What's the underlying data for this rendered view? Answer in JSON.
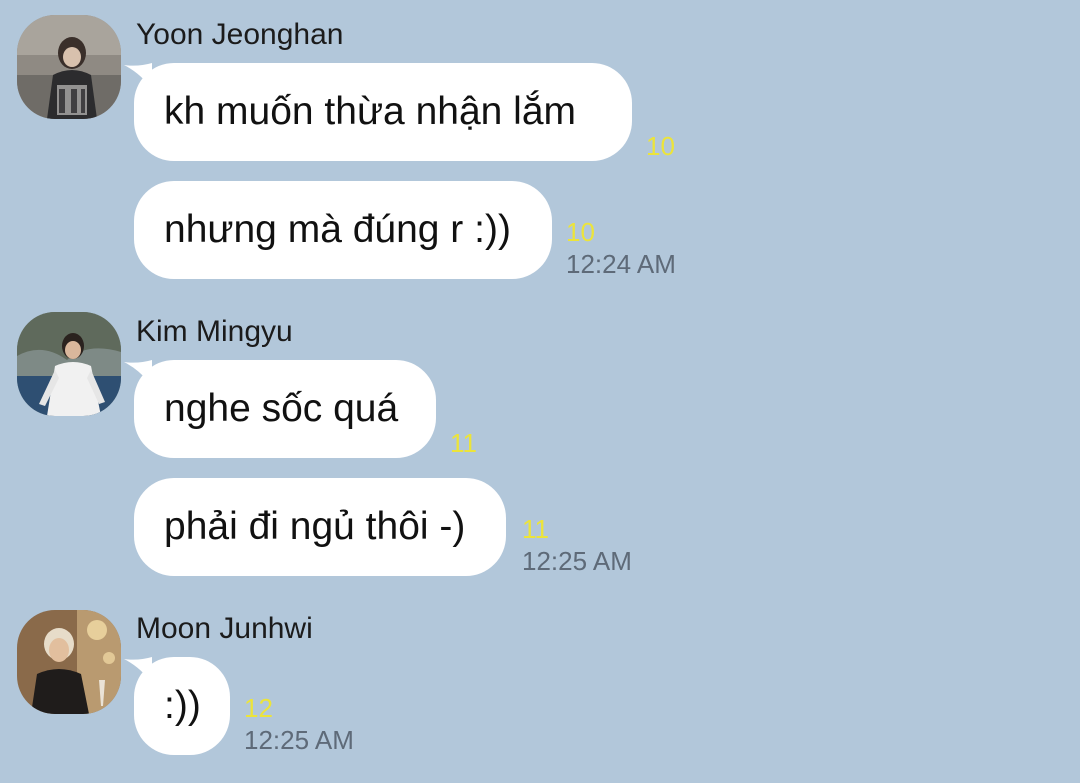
{
  "groups": [
    {
      "sender": "Yoon Jeonghan",
      "avatar_icon": "profile-photo-icon",
      "messages": [
        {
          "text": "kh muốn thừa nhận lắm",
          "unread": "10",
          "time": ""
        },
        {
          "text": "nhưng mà đúng r :))",
          "unread": "10",
          "time": "12:24 AM"
        }
      ]
    },
    {
      "sender": "Kim Mingyu",
      "avatar_icon": "profile-photo-icon",
      "messages": [
        {
          "text": "nghe sốc quá",
          "unread": "11",
          "time": ""
        },
        {
          "text": "phải đi ngủ thôi -)",
          "unread": "11",
          "time": "12:25 AM"
        }
      ]
    },
    {
      "sender": "Moon Junhwi",
      "avatar_icon": "profile-photo-icon",
      "messages": [
        {
          "text": ":))",
          "unread": "12",
          "time": "12:25 AM"
        }
      ]
    }
  ],
  "colors": {
    "background": "#b2c7da",
    "bubble": "#ffffff",
    "unread": "#ece43a",
    "time": "#5e6a78"
  }
}
